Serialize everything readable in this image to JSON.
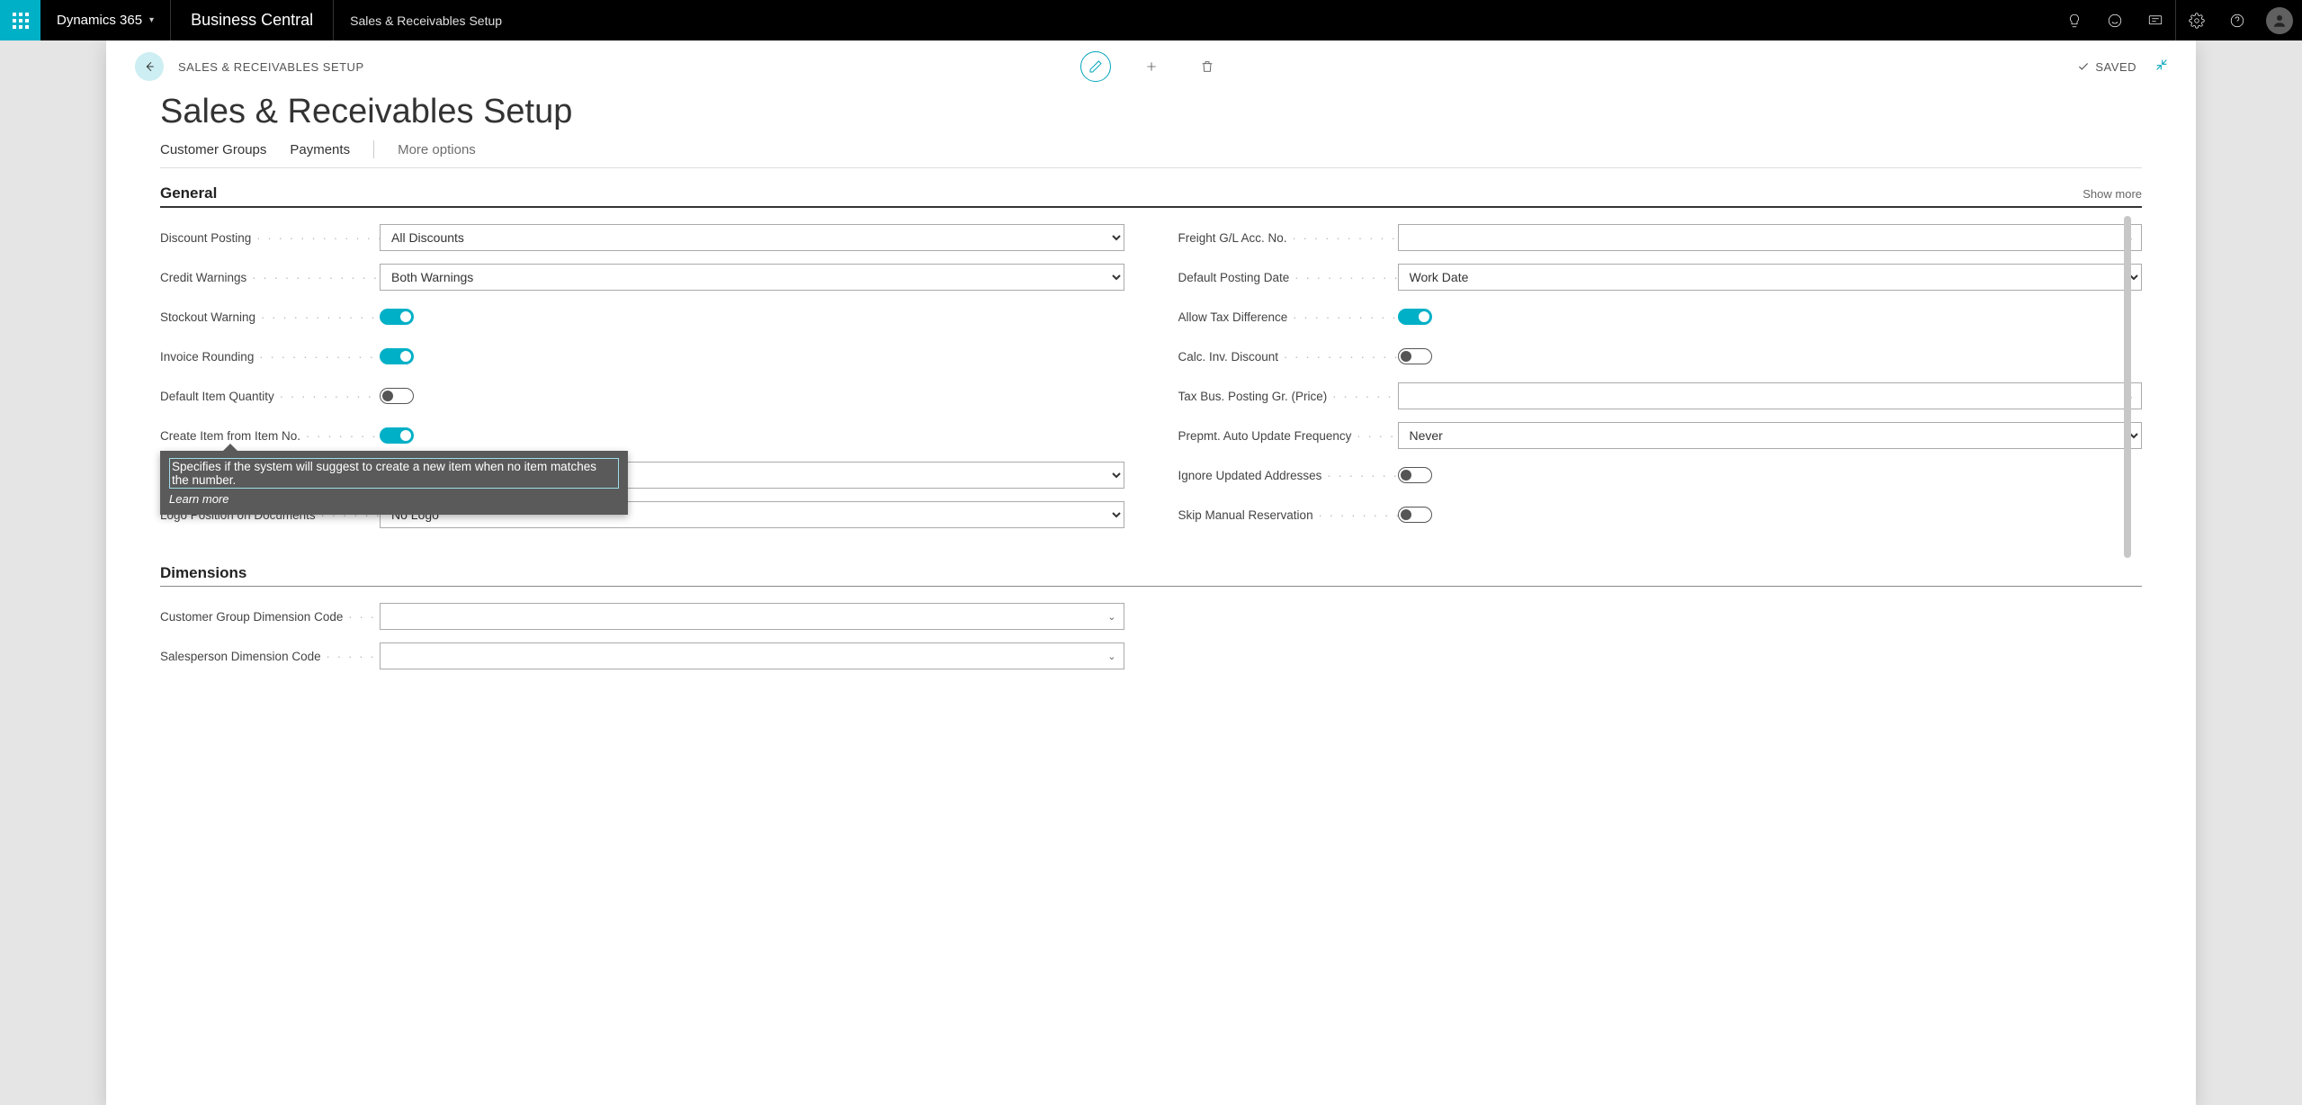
{
  "topbar": {
    "brand": "Dynamics 365",
    "product": "Business Central",
    "crumb": "Sales & Receivables Setup"
  },
  "header": {
    "breadcrumb": "SALES & RECEIVABLES SETUP",
    "saved": "SAVED",
    "title": "Sales & Receivables Setup"
  },
  "tabs": {
    "t1": "Customer Groups",
    "t2": "Payments",
    "more": "More options"
  },
  "section_general": {
    "title": "General",
    "showmore": "Show more"
  },
  "labels": {
    "discount_posting": "Discount Posting",
    "credit_warnings": "Credit Warnings",
    "stockout_warning": "Stockout Warning",
    "invoice_rounding": "Invoice Rounding",
    "default_item_qty": "Default Item Quantity",
    "create_item": "Create Item from Item No.",
    "logo_pos": "Logo Position on Documents",
    "freight": "Freight G/L Acc. No.",
    "default_posting_date": "Default Posting Date",
    "allow_tax_diff": "Allow Tax Difference",
    "calc_inv_disc": "Calc. Inv. Discount",
    "tax_bus": "Tax Bus. Posting Gr. (Price)",
    "prepmt": "Prepmt. Auto Update Frequency",
    "ignore_addr": "Ignore Updated Addresses",
    "skip_manual": "Skip Manual Reservation"
  },
  "values": {
    "discount_posting": "All Discounts",
    "credit_warnings": "Both Warnings",
    "logo_pos": "No Logo",
    "freight": "",
    "default_posting_date": "Work Date",
    "tax_bus": "",
    "prepmt": "Never",
    "hidden_select": ""
  },
  "toggles": {
    "stockout_warning": true,
    "invoice_rounding": true,
    "default_item_qty": false,
    "create_item": true,
    "allow_tax_diff": true,
    "calc_inv_disc": false,
    "ignore_addr": false,
    "skip_manual": false
  },
  "tooltip": {
    "text": "Specifies if the system will suggest to create a new item when no item matches the number.",
    "learn": "Learn more"
  },
  "section_dimensions": {
    "title": "Dimensions"
  },
  "dim_labels": {
    "cust_group": "Customer Group Dimension Code",
    "salesperson": "Salesperson Dimension Code"
  },
  "dim_values": {
    "cust_group": "",
    "salesperson": ""
  }
}
